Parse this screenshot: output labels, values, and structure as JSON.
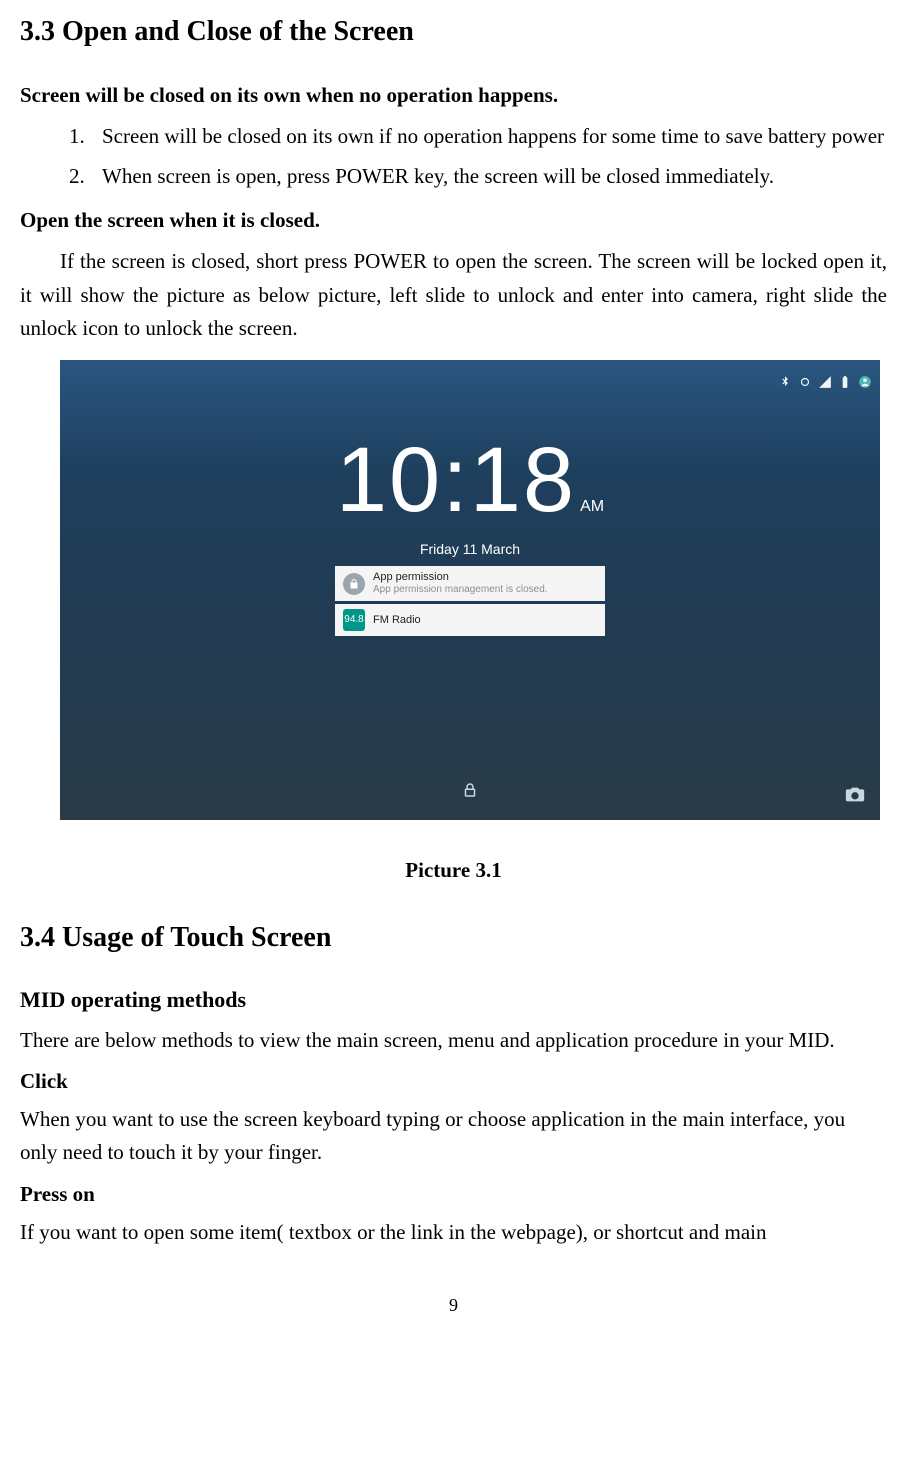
{
  "section33": {
    "heading": "3.3 Open and Close of the Screen",
    "close_heading": "Screen will be closed on its own when no operation happens.",
    "close_items": [
      "Screen will be closed on its own if no operation happens for some time to save battery power",
      "When screen is open, press POWER key, the screen will be closed immediately."
    ],
    "open_heading": "Open the screen when it is closed.",
    "open_para": "If the screen is closed, short press POWER to open the screen. The screen will be locked open it, it will show the picture as below picture, left slide to unlock and enter into camera, right slide the unlock icon to unlock the screen."
  },
  "lockscreen": {
    "time": "10:18",
    "ampm": "AM",
    "date": "Friday 11 March",
    "notifications": [
      {
        "icon_name": "lock-icon",
        "title": "App permission",
        "subtitle": "App permission management is closed."
      },
      {
        "icon_name": "radio-icon",
        "icon_text": "94.8",
        "title": "FM Radio",
        "subtitle": ""
      }
    ]
  },
  "picture_caption": "Picture 3.1",
  "section34": {
    "heading": "3.4 Usage of Touch Screen",
    "methods_heading": "MID operating methods",
    "methods_intro": "There are below methods to view the main screen, menu and application procedure in your MID.",
    "click_heading": "Click",
    "click_body": "When you want to use the screen keyboard typing or choose application in the main interface, you only need to touch it by your finger.",
    "press_heading": "Press on",
    "press_body": "If you want to open some item( textbox or the link in the webpage), or shortcut and main"
  },
  "page_number": "9"
}
